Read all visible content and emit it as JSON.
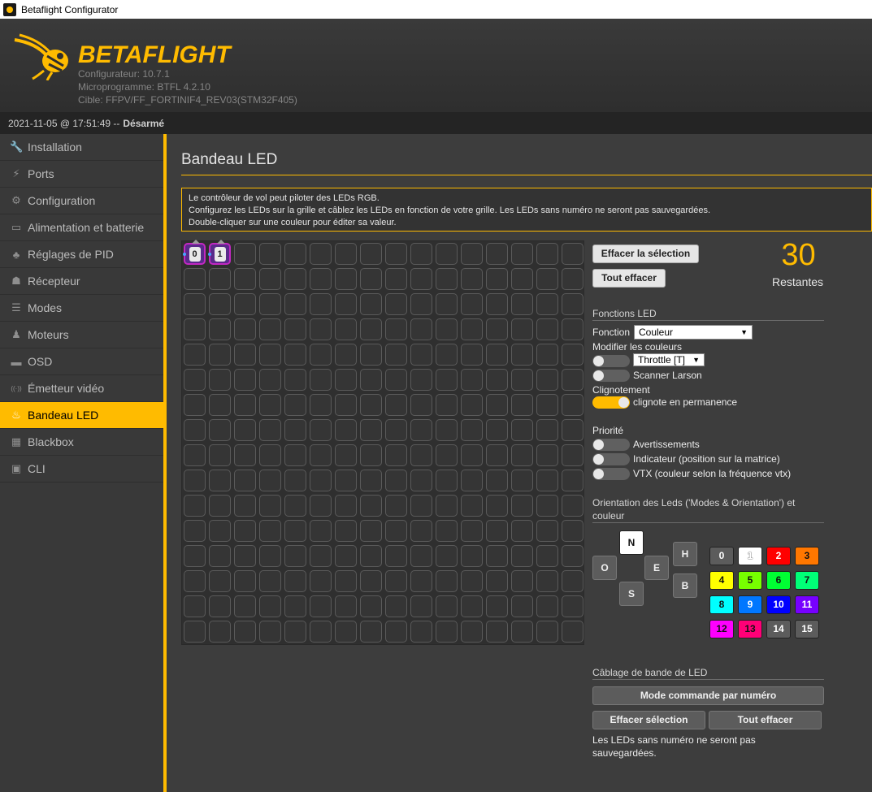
{
  "window": {
    "title": "Betaflight Configurator"
  },
  "header": {
    "logo_text": "BETAFLIGHT",
    "configurator": "Configurateur: 10.7.1",
    "firmware": "Microprogramme: BTFL 4.2.10",
    "target": "Cible: FFPV/FF_FORTINIF4_REV03(STM32F405)"
  },
  "status": {
    "datetime": "2021-11-05 @ 17:51:49 --",
    "armed": "Désarmé"
  },
  "sidebar": {
    "items": [
      {
        "label": "Installation",
        "icon": "wrench-icon",
        "glyph": "🔧"
      },
      {
        "label": "Ports",
        "icon": "plug-icon",
        "glyph": "⚡"
      },
      {
        "label": "Configuration",
        "icon": "gear-icon",
        "glyph": "⚙"
      },
      {
        "label": "Alimentation et batterie",
        "icon": "battery-icon",
        "glyph": "▭"
      },
      {
        "label": "Réglages de PID",
        "icon": "pid-tree-icon",
        "glyph": "♣"
      },
      {
        "label": "Récepteur",
        "icon": "receiver-icon",
        "glyph": "☗"
      },
      {
        "label": "Modes",
        "icon": "toggles-icon",
        "glyph": "☰"
      },
      {
        "label": "Moteurs",
        "icon": "motor-icon",
        "glyph": "♟"
      },
      {
        "label": "OSD",
        "icon": "osd-icon",
        "glyph": "▬"
      },
      {
        "label": "Émetteur vidéo",
        "icon": "antenna-icon",
        "glyph": "((·))"
      },
      {
        "label": "Bandeau LED",
        "icon": "led-icon",
        "glyph": "♨"
      },
      {
        "label": "Blackbox",
        "icon": "chip-icon",
        "glyph": "▦"
      },
      {
        "label": "CLI",
        "icon": "terminal-icon",
        "glyph": "▣"
      }
    ],
    "active_index": 10
  },
  "page": {
    "title": "Bandeau LED",
    "note_lines": [
      "Le contrôleur de vol peut piloter des LEDs RGB.",
      "Configurez les LEDs sur la grille et câblez les LEDs en fonction de votre grille. Les LEDs sans numéro ne seront pas sauvegardées.",
      "Double-cliquer sur une couleur pour éditer sa valeur."
    ]
  },
  "grid": {
    "columns": 16,
    "rows": 16,
    "leds": [
      {
        "index": 0,
        "label": "0"
      },
      {
        "index": 1,
        "label": "1"
      }
    ]
  },
  "buttons": {
    "clear_selection": "Effacer la sélection",
    "clear_all": "Tout effacer"
  },
  "remaining": {
    "count": "30",
    "label": "Restantes"
  },
  "functions": {
    "section_title": "Fonctions LED",
    "function_label": "Fonction",
    "function_value": "Couleur",
    "modifiers_label": "Modifier les couleurs",
    "throttle_value": "Throttle [T]",
    "larson_label": "Scanner Larson",
    "blink_section": "Clignotement",
    "blink_label": "clignote en permanence",
    "priority_section": "Priorité",
    "warnings_label": "Avertissements",
    "indicator_label": "Indicateur (position sur la matrice)",
    "vtx_label": "VTX (couleur selon la fréquence vtx)"
  },
  "orientation": {
    "section_title_line1": "Orientation des Leds ('Modes & Orientation') et",
    "section_title_line2": "couleur",
    "directions": {
      "n": "N",
      "o": "O",
      "e": "E",
      "s": "S",
      "h": "H",
      "b": "B"
    }
  },
  "colors": [
    {
      "label": "0",
      "bg": "#5c5c5c",
      "fg": "#ffffff"
    },
    {
      "label": "1",
      "bg": "#ffffff",
      "fg": "#ffffff"
    },
    {
      "label": "2",
      "bg": "#ff0000",
      "fg": "#ffffff"
    },
    {
      "label": "3",
      "bg": "#ff7700",
      "fg": "#111111"
    },
    {
      "label": "4",
      "bg": "#ffff00",
      "fg": "#111111"
    },
    {
      "label": "5",
      "bg": "#77ff00",
      "fg": "#111111"
    },
    {
      "label": "6",
      "bg": "#00ff33",
      "fg": "#111111"
    },
    {
      "label": "7",
      "bg": "#00ff77",
      "fg": "#111111"
    },
    {
      "label": "8",
      "bg": "#00ffff",
      "fg": "#111111"
    },
    {
      "label": "9",
      "bg": "#0077ff",
      "fg": "#ffffff"
    },
    {
      "label": "10",
      "bg": "#0000ff",
      "fg": "#ffffff"
    },
    {
      "label": "11",
      "bg": "#7700ff",
      "fg": "#ffffff"
    },
    {
      "label": "12",
      "bg": "#ff00ff",
      "fg": "#111111"
    },
    {
      "label": "13",
      "bg": "#ff0077",
      "fg": "#111111"
    },
    {
      "label": "14",
      "bg": "#5c5c5c",
      "fg": "#ffffff"
    },
    {
      "label": "15",
      "bg": "#5c5c5c",
      "fg": "#ffffff"
    }
  ],
  "wiring": {
    "section_title": "Câblage de bande de LED",
    "numbered_mode": "Mode commande par numéro",
    "clear_selection": "Effacer sélection",
    "clear_all": "Tout effacer",
    "note": "Les LEDs sans numéro ne seront pas sauvegardées."
  }
}
